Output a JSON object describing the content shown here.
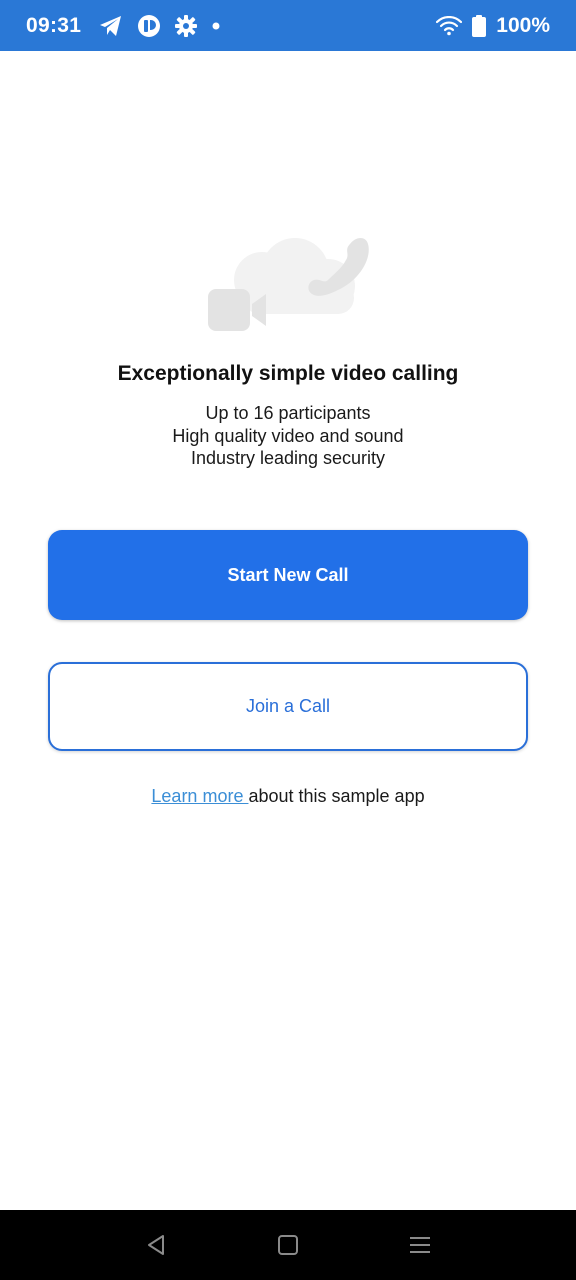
{
  "status_bar": {
    "time": "09:31",
    "battery": "100%",
    "icons": [
      "telegram-icon",
      "app-icon",
      "settings-icon",
      "dot-icon",
      "wifi-icon",
      "battery-icon"
    ]
  },
  "hero": {
    "icon": "cloud-video-phone-illustration"
  },
  "headline": "Exceptionally simple video calling",
  "features": [
    "Up to 16 participants",
    "High quality video and sound",
    "Industry leading security"
  ],
  "actions": {
    "start_label": "Start New Call",
    "join_label": "Join a Call"
  },
  "footer": {
    "link_text": "Learn more ",
    "suffix_text": "about this sample app"
  },
  "nav": {
    "back": "back-icon",
    "home": "home-icon",
    "menu": "menu-icon"
  },
  "colors": {
    "status_bar": "#2a78d6",
    "primary": "#2270e8",
    "link": "#3b8ed6"
  }
}
